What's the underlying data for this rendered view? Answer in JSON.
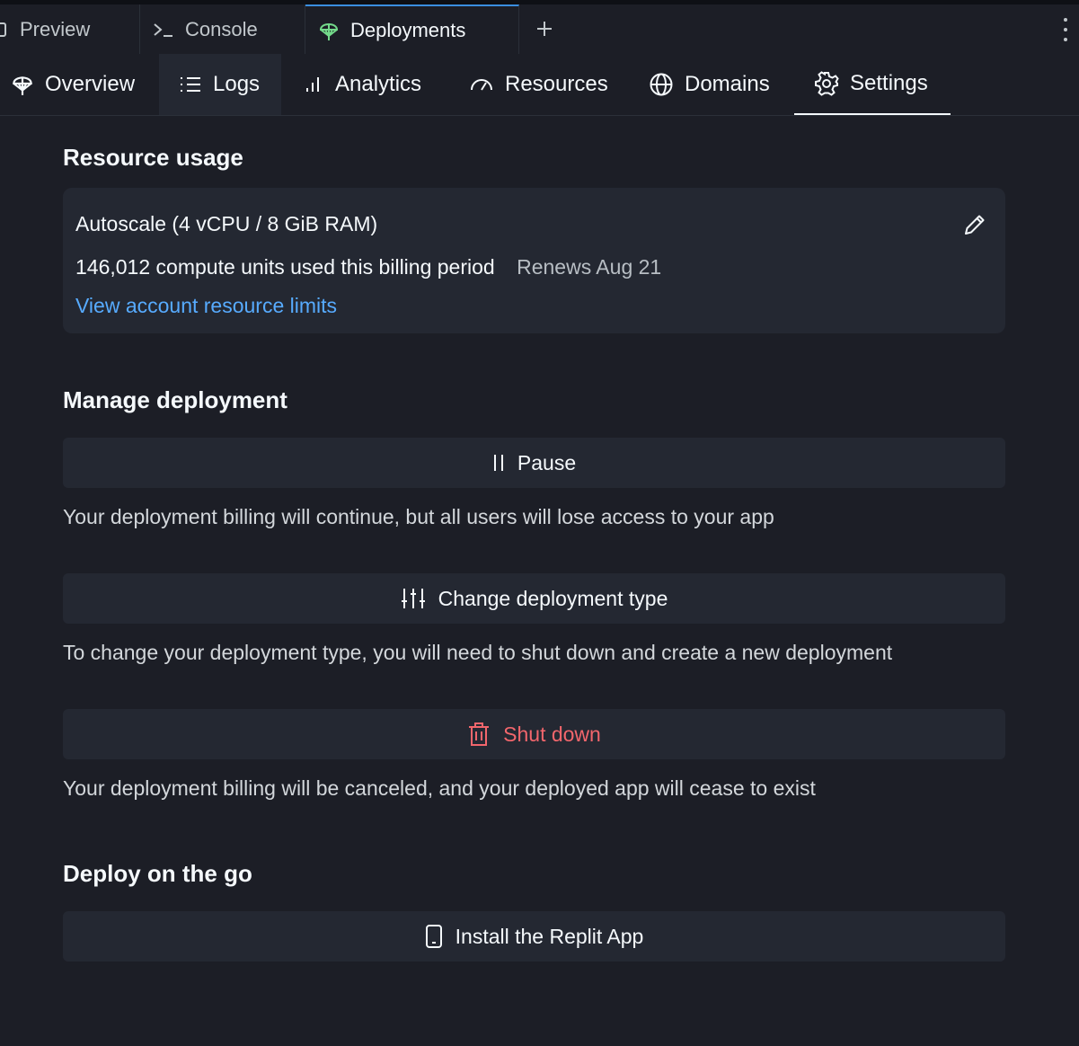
{
  "tabs": {
    "preview": {
      "label": "Preview",
      "icon": "preview-icon"
    },
    "console": {
      "label": "Console",
      "icon": "console-prompt-icon"
    },
    "deployments": {
      "label": "Deployments",
      "icon": "deployments-icon"
    }
  },
  "subnav": {
    "overview": {
      "label": "Overview",
      "icon": "deployments-icon"
    },
    "logs": {
      "label": "Logs",
      "icon": "list-icon"
    },
    "analytics": {
      "label": "Analytics",
      "icon": "bar-chart-icon"
    },
    "resources": {
      "label": "Resources",
      "icon": "gauge-icon"
    },
    "domains": {
      "label": "Domains",
      "icon": "globe-icon"
    },
    "settings": {
      "label": "Settings",
      "icon": "gear-icon"
    }
  },
  "resource_usage": {
    "title": "Resource usage",
    "plan": "Autoscale (4 vCPU / 8 GiB RAM)",
    "usage": "146,012 compute units used this billing period",
    "renews": "Renews Aug 21",
    "limits_link": "View account resource limits"
  },
  "manage": {
    "title": "Manage deployment",
    "pause_label": "Pause",
    "pause_desc": "Your deployment billing will continue, but all users will lose access to your app",
    "change_label": "Change deployment type",
    "change_desc": "To change your deployment type, you will need to shut down and create a new deployment",
    "shutdown_label": "Shut down",
    "shutdown_desc": "Your deployment billing will be canceled, and your deployed app will cease to exist"
  },
  "deploy_go": {
    "title": "Deploy on the go",
    "install_label": "Install the Replit App"
  },
  "colors": {
    "background": "#1c1e26",
    "surface": "#242832",
    "link": "#57abff",
    "danger": "#f2666c",
    "deploy_icon": "#73d98a"
  }
}
